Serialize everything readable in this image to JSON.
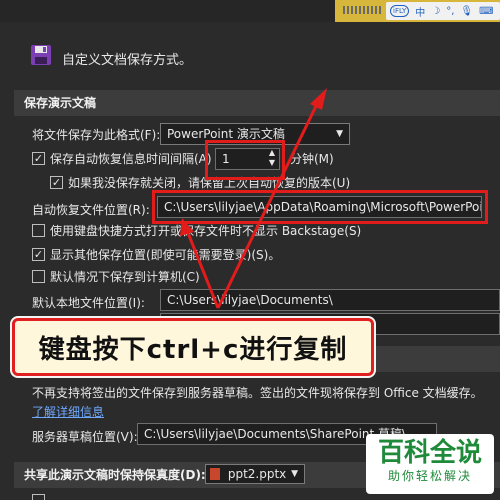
{
  "header": {
    "title": "自定义文档保存方式。"
  },
  "ime_bar": {
    "badge": "iFLY"
  },
  "save_section": {
    "title": "保存演示文稿",
    "format_label": "将文件保存为此格式(F):",
    "format_value": "PowerPoint 演示文稿",
    "autorecover_label": "保存自动恢复信息时间间隔(A)",
    "autorecover_checked": true,
    "interval_value": "1",
    "interval_unit": "分钟(M)",
    "keep_last_label": "如果我没保存就关闭，请保留上次自动恢复的版本(U)",
    "keep_last_checked": true,
    "autorecover_location_label": "自动恢复文件位置(R):",
    "autorecover_location_value": "C:\\Users\\lilyjae\\AppData\\Roaming\\Microsoft\\PowerPoint\\",
    "backstage_label": "使用键盘快捷方式打开或保存文件时不显示 Backstage(S)",
    "backstage_checked": false,
    "show_other_label": "显示其他保存位置(即使可能需要登录)(S)。",
    "show_other_checked": true,
    "default_computer_label": "默认情况下保存到计算机(C)",
    "default_computer_checked": false,
    "default_local_label": "默认本地文件位置(I):",
    "default_local_value": "C:\\Users\\lilyjae\\Documents\\"
  },
  "annotation": {
    "text": "键盘按下ctrl+c进行复制"
  },
  "offline_section": {
    "info_text": "不再支持将签出的文件保存到服务器草稿。签出的文件现将保存到 Office 文档缓存。",
    "learn_more": "了解详细信息",
    "drafts_label": "服务器草稿位置(V):",
    "drafts_value": "C:\\Users\\lilyjae\\Documents\\SharePoint 草稿\\"
  },
  "fidelity_section": {
    "title": "共享此演示文稿时保持保真度(D):",
    "file_value": "ppt2.pptx"
  },
  "watermark": {
    "title": "百科全说",
    "subtitle": "助你轻松解决"
  },
  "colors": {
    "highlight_red": "#e21b1b",
    "callout_border": "#e02020",
    "link_blue": "#6fa8ff",
    "watermark_green": "#1f8a3a"
  }
}
